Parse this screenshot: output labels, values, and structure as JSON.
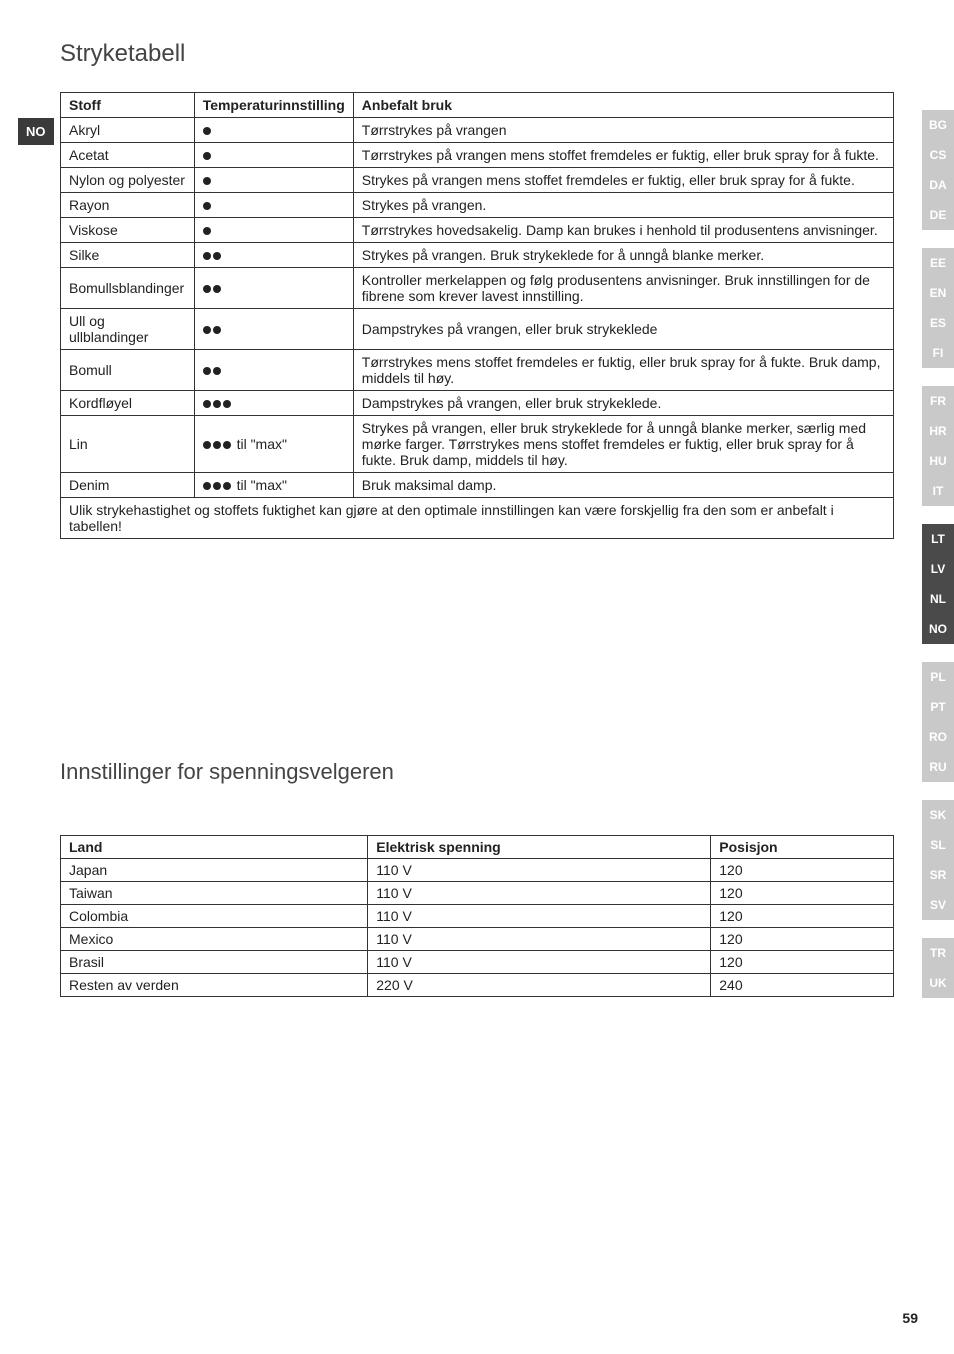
{
  "current_lang_badge": "NO",
  "heading_ironing": "Stryketabell",
  "ironing_table": {
    "headers": [
      "Stoff",
      "Temperaturinnstilling",
      "Anbefalt bruk"
    ],
    "rows": [
      {
        "fabric": "Akryl",
        "dots": 1,
        "suffix": "",
        "use": "Tørrstrykes på vrangen"
      },
      {
        "fabric": "Acetat",
        "dots": 1,
        "suffix": "",
        "use": "Tørrstrykes på vrangen mens stoffet fremdeles er fuktig, eller bruk spray for å fukte."
      },
      {
        "fabric": "Nylon og polyester",
        "dots": 1,
        "suffix": "",
        "use": "Strykes på vrangen mens stoffet fremdeles er fuktig, eller bruk spray for å fukte."
      },
      {
        "fabric": "Rayon",
        "dots": 1,
        "suffix": "",
        "use": "Strykes på vrangen."
      },
      {
        "fabric": "Viskose",
        "dots": 1,
        "suffix": "",
        "use": "Tørrstrykes hovedsakelig. Damp kan brukes i henhold til produsentens anvisninger."
      },
      {
        "fabric": "Silke",
        "dots": 2,
        "suffix": "",
        "use": "Strykes på vrangen. Bruk strykeklede for å unngå blanke merker."
      },
      {
        "fabric": "Bomullsblandinger",
        "dots": 2,
        "suffix": "",
        "use": "Kontroller merkelappen og følg produsentens anvisninger. Bruk innstillingen for de fibrene som krever lavest innstilling."
      },
      {
        "fabric": "Ull og ullblandinger",
        "dots": 2,
        "suffix": "",
        "use": "Dampstrykes på vrangen, eller bruk strykeklede"
      },
      {
        "fabric": "Bomull",
        "dots": 2,
        "suffix": "",
        "use": "Tørrstrykes mens stoffet fremdeles er fuktig, eller bruk spray for å fukte. Bruk damp, middels til høy."
      },
      {
        "fabric": "Kordfløyel",
        "dots": 3,
        "suffix": "",
        "use": "Dampstrykes på vrangen, eller bruk strykeklede."
      },
      {
        "fabric": "Lin",
        "dots": 3,
        "suffix": " til \"max\"",
        "use": "Strykes på vrangen, eller bruk strykeklede for å unngå blanke merker, særlig med mørke farger. Tørrstrykes mens stoffet fremdeles er fuktig, eller bruk spray for å fukte. Bruk damp, middels til høy."
      },
      {
        "fabric": "Denim",
        "dots": 3,
        "suffix": " til \"max\"",
        "use": "Bruk maksimal damp."
      }
    ],
    "footnote": "Ulik strykehastighet og stoffets fuktighet kan gjøre at den optimale innstillingen kan være forskjellig fra den som er anbefalt i tabellen!"
  },
  "heading_voltage": "Innstillinger for spenningsvelgeren",
  "voltage_table": {
    "headers": [
      "Land",
      "Elektrisk spenning",
      "Posisjon"
    ],
    "rows": [
      {
        "land": "Japan",
        "volt": "110 V",
        "pos": "120"
      },
      {
        "land": "Taiwan",
        "volt": "110 V",
        "pos": "120"
      },
      {
        "land": "Colombia",
        "volt": "110 V",
        "pos": "120"
      },
      {
        "land": "Mexico",
        "volt": "110 V",
        "pos": "120"
      },
      {
        "land": "Brasil",
        "volt": "110 V",
        "pos": "120"
      },
      {
        "land": "Resten av verden",
        "volt": "220 V",
        "pos": "240"
      }
    ]
  },
  "side_tabs": [
    {
      "labels": [
        "BG",
        "CS",
        "DA",
        "DE"
      ],
      "active": []
    },
    {
      "labels": [
        "EE",
        "EN",
        "ES",
        "FI"
      ],
      "active": []
    },
    {
      "labels": [
        "FR",
        "HR",
        "HU",
        "IT"
      ],
      "active": []
    },
    {
      "labels": [
        "LT",
        "LV",
        "NL",
        "NO"
      ],
      "active": [
        "LT",
        "LV",
        "NL",
        "NO"
      ]
    },
    {
      "labels": [
        "PL",
        "PT",
        "RO",
        "RU"
      ],
      "active": []
    },
    {
      "labels": [
        "SK",
        "SL",
        "SR",
        "SV"
      ],
      "active": []
    },
    {
      "labels": [
        "TR",
        "UK"
      ],
      "active": []
    }
  ],
  "page_number": "59"
}
